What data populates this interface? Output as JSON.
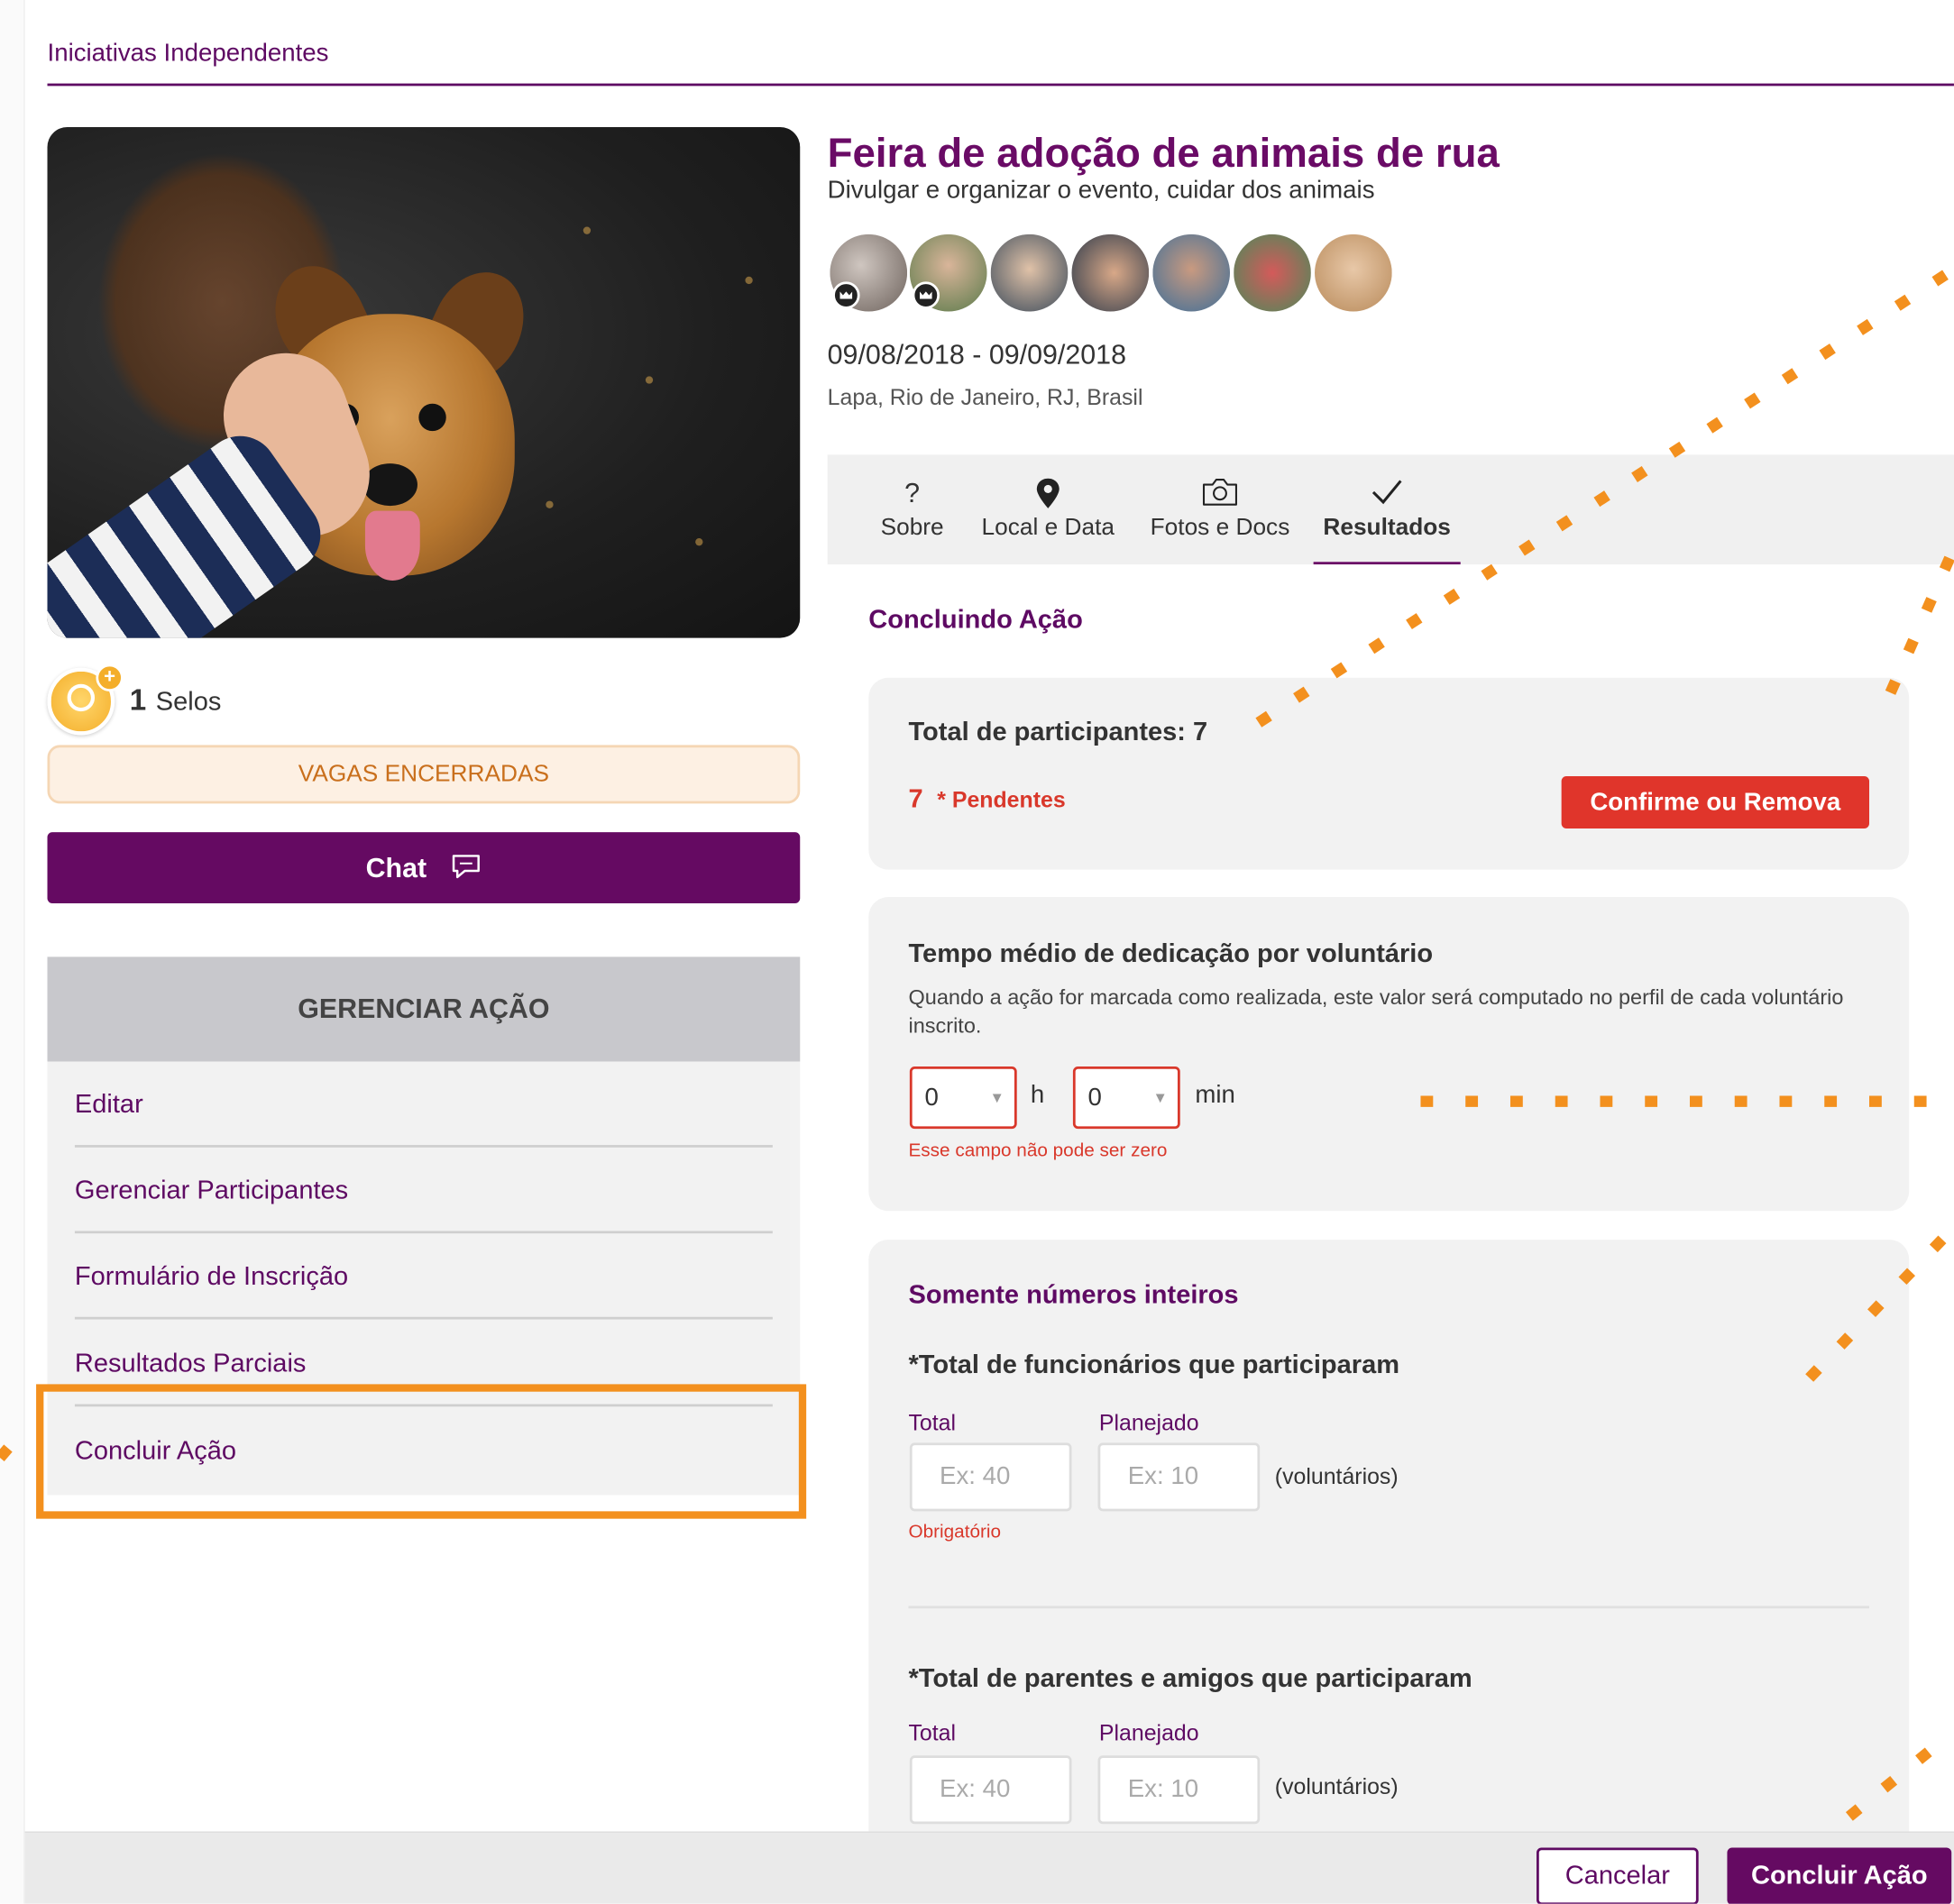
{
  "breadcrumb": "Iniciativas Independentes",
  "event": {
    "title": "Feira de adoção de animais de rua",
    "subtitle": "Divulgar e organizar o evento, cuidar dos animais",
    "dates": "09/08/2018 - 09/09/2018",
    "place": "Lapa, Rio de Janeiro, RJ, Brasil"
  },
  "selos": {
    "count": "1",
    "label": "Selos"
  },
  "vagas_label": "VAGAS ENCERRADAS",
  "chat_label": "Chat",
  "manage": {
    "header": "GERENCIAR AÇÃO",
    "items": [
      "Editar",
      "Gerenciar Participantes",
      "Formulário de Inscrição",
      "Resultados Parciais",
      "Concluir Ação"
    ]
  },
  "tabs": [
    {
      "icon": "question-icon",
      "label": "Sobre"
    },
    {
      "icon": "location-pin-icon",
      "label": "Local e Data"
    },
    {
      "icon": "camera-icon",
      "label": "Fotos e Docs"
    },
    {
      "icon": "check-icon",
      "label": "Resultados",
      "active": true
    }
  ],
  "section_title": "Concluindo Ação",
  "participants": {
    "total_label": "Total de participantes: 7",
    "pending_count": "7",
    "pending_label": "* Pendentes",
    "confirm_label": "Confirme ou Remova"
  },
  "time": {
    "title": "Tempo médio de dedicação por voluntário",
    "description": "Quando a ação for marcada como realizada, este valor será computado no perfil de cada voluntário inscrito.",
    "hours_value": "0",
    "hours_unit": "h",
    "minutes_value": "0",
    "minutes_unit": "min",
    "error": "Esse campo não pode ser zero"
  },
  "integers": {
    "title": "Somente números inteiros",
    "questions": [
      {
        "title": "*Total de funcionários que participaram",
        "total_label": "Total",
        "planned_label": "Planejado",
        "total_placeholder": "Ex: 40",
        "planned_placeholder": "Ex: 10",
        "unit": "(voluntários)",
        "required": "Obrigatório"
      },
      {
        "title": "*Total de parentes e amigos que participaram",
        "total_label": "Total",
        "planned_label": "Planejado",
        "total_placeholder": "Ex: 40",
        "planned_placeholder": "Ex: 10",
        "unit": "(voluntários)"
      }
    ]
  },
  "footer": {
    "cancel_label": "Cancelar",
    "finish_label": "Concluir Ação"
  },
  "colors": {
    "brand": "#650a62",
    "error": "#e0352b",
    "highlight": "#f3901e"
  }
}
